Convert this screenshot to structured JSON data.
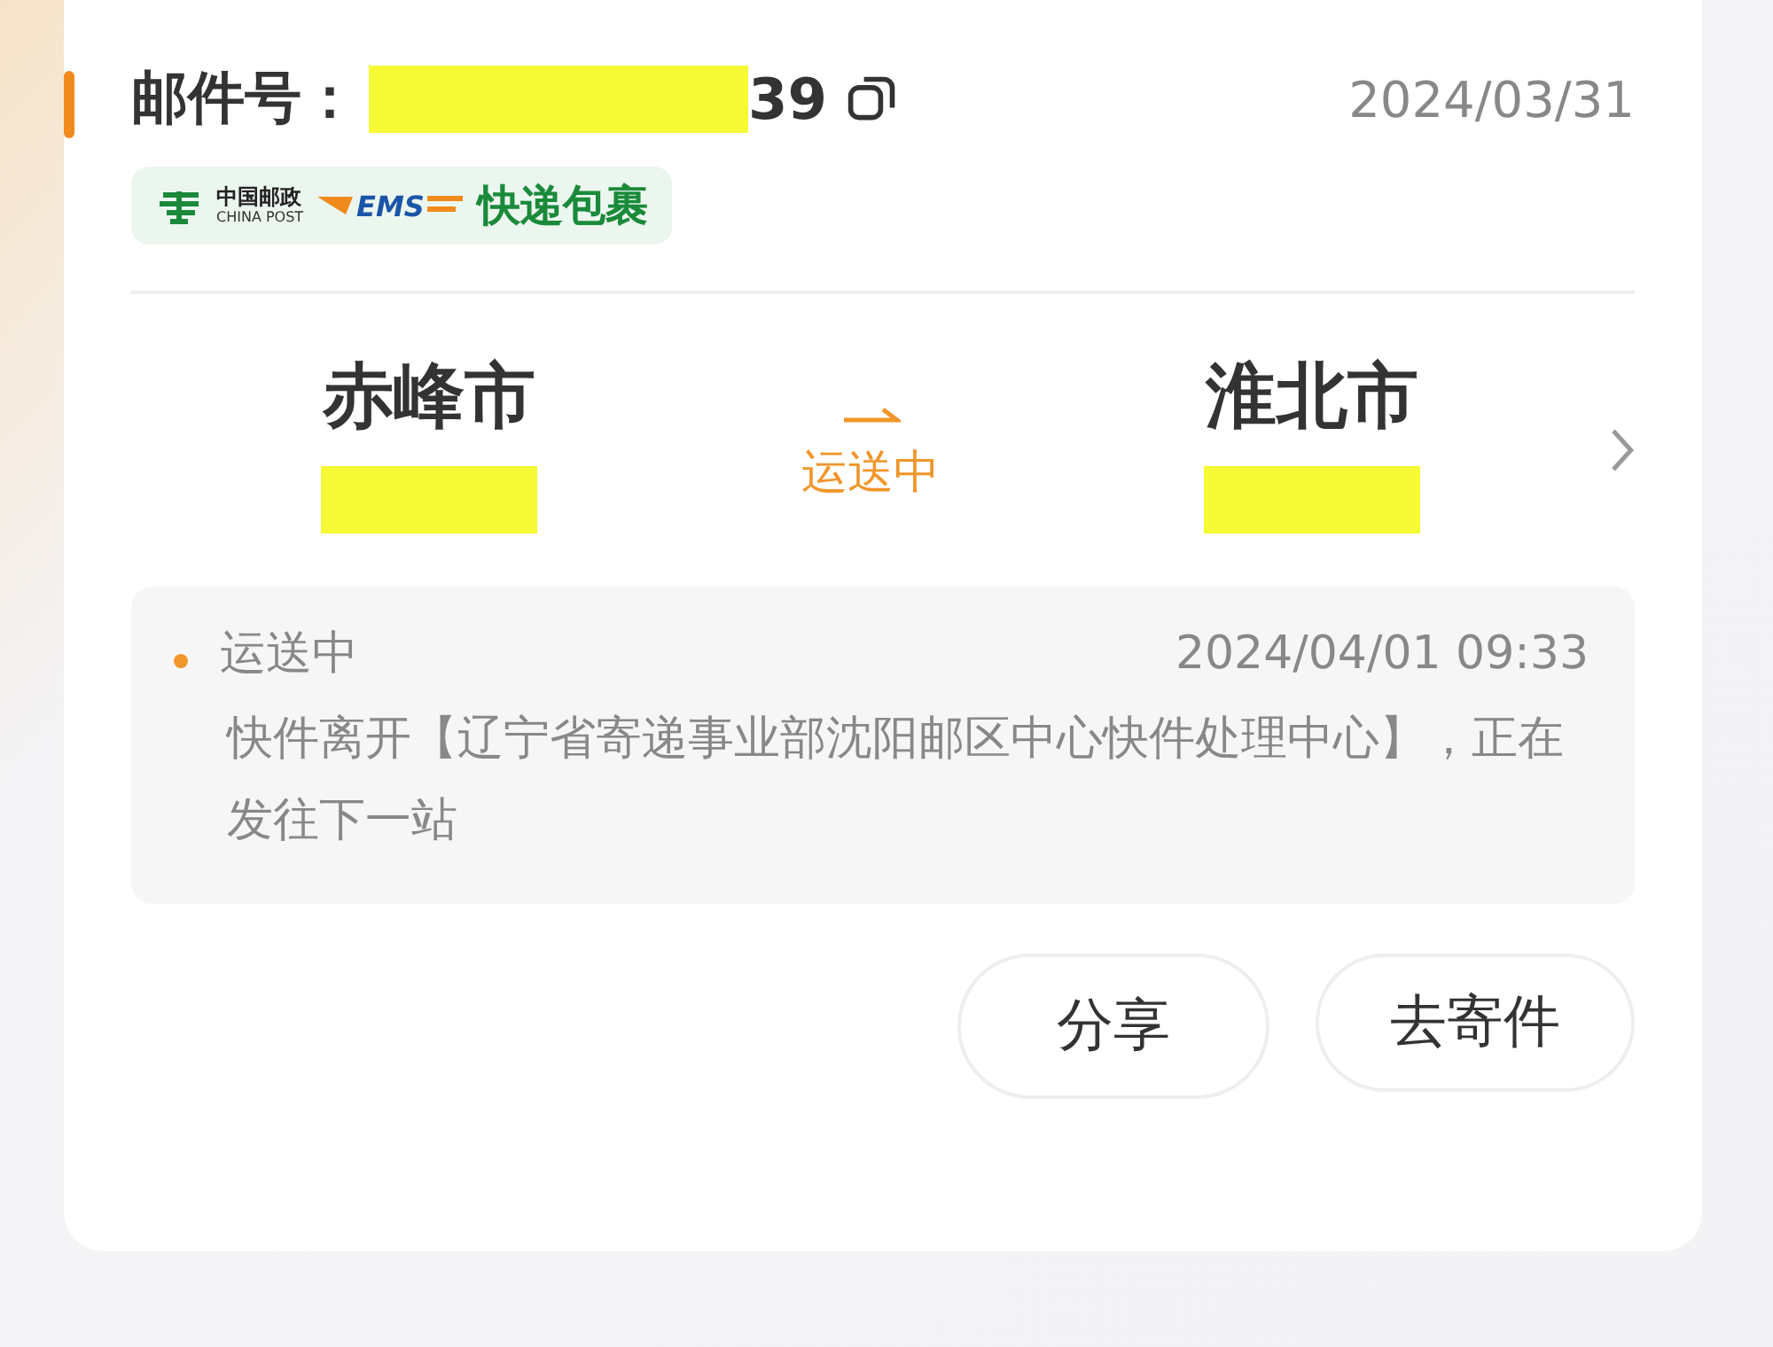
{
  "shipment": {
    "label": "邮件号：",
    "number_redacted": true,
    "number_suffix": "39",
    "date": "2024/03/31"
  },
  "carrier_badge": {
    "brand_cn": "中国邮政",
    "brand_en": "CHINA POST",
    "service_logo": "EMS",
    "service": "快递包裹"
  },
  "route": {
    "origin": {
      "city": "赤峰市",
      "detail_redacted": true
    },
    "status": "运送中",
    "destination": {
      "city": "淮北市",
      "detail_redacted": true
    }
  },
  "latest_event": {
    "status": "运送中",
    "time": "2024/04/01 09:33",
    "description": "快件离开【辽宁省寄递事业部沈阳邮区中心快件处理中心】，正在发往下一站"
  },
  "buttons": [
    {
      "label": "分享"
    },
    {
      "label": "去寄件"
    }
  ]
}
